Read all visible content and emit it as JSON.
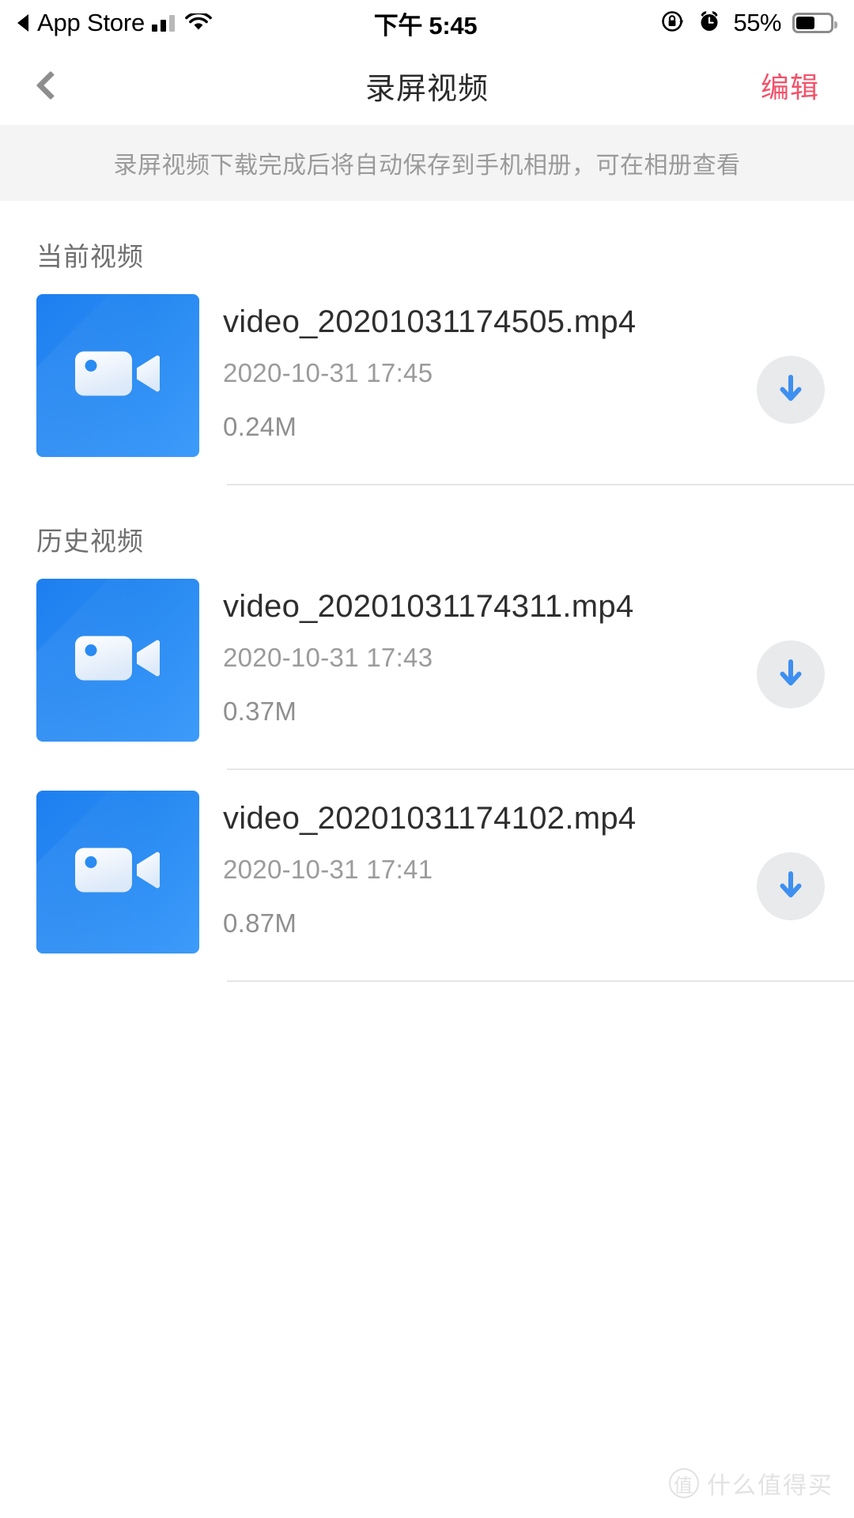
{
  "statusbar": {
    "back_label": "App Store",
    "time": "下午 5:45",
    "battery_percent": "55%",
    "icons": {
      "back_arrow": "back-triangle-icon",
      "signal": "cellular-signal-icon",
      "wifi": "wifi-icon",
      "rotation_lock": "rotation-lock-icon",
      "alarm": "alarm-clock-icon",
      "battery": "battery-icon"
    }
  },
  "navbar": {
    "back_icon": "chevron-left-icon",
    "title": "录屏视频",
    "edit_label": "编辑",
    "edit_color": "#f2526a"
  },
  "banner": {
    "text": "录屏视频下载完成后将自动保存到手机相册，可在相册查看"
  },
  "sections": [
    {
      "title": "当前视频",
      "items": [
        {
          "filename": "video_20201031174505.mp4",
          "date": "2020-10-31 17:45",
          "size": "0.24M",
          "thumb_icon": "video-camera-icon",
          "download_icon": "download-arrow-icon"
        }
      ]
    },
    {
      "title": "历史视频",
      "items": [
        {
          "filename": "video_20201031174311.mp4",
          "date": "2020-10-31 17:43",
          "size": "0.37M",
          "thumb_icon": "video-camera-icon",
          "download_icon": "download-arrow-icon"
        },
        {
          "filename": "video_20201031174102.mp4",
          "date": "2020-10-31 17:41",
          "size": "0.87M",
          "thumb_icon": "video-camera-icon",
          "download_icon": "download-arrow-icon"
        }
      ]
    }
  ],
  "watermark": {
    "badge": "值",
    "text": "什么值得买"
  },
  "colors": {
    "accent_blue": "#3d8ff0",
    "thumb_gradient_start": "#1d7ff0",
    "thumb_gradient_end": "#3d9bfa",
    "edit_red": "#f2526a",
    "banner_bg": "#f4f4f4"
  }
}
